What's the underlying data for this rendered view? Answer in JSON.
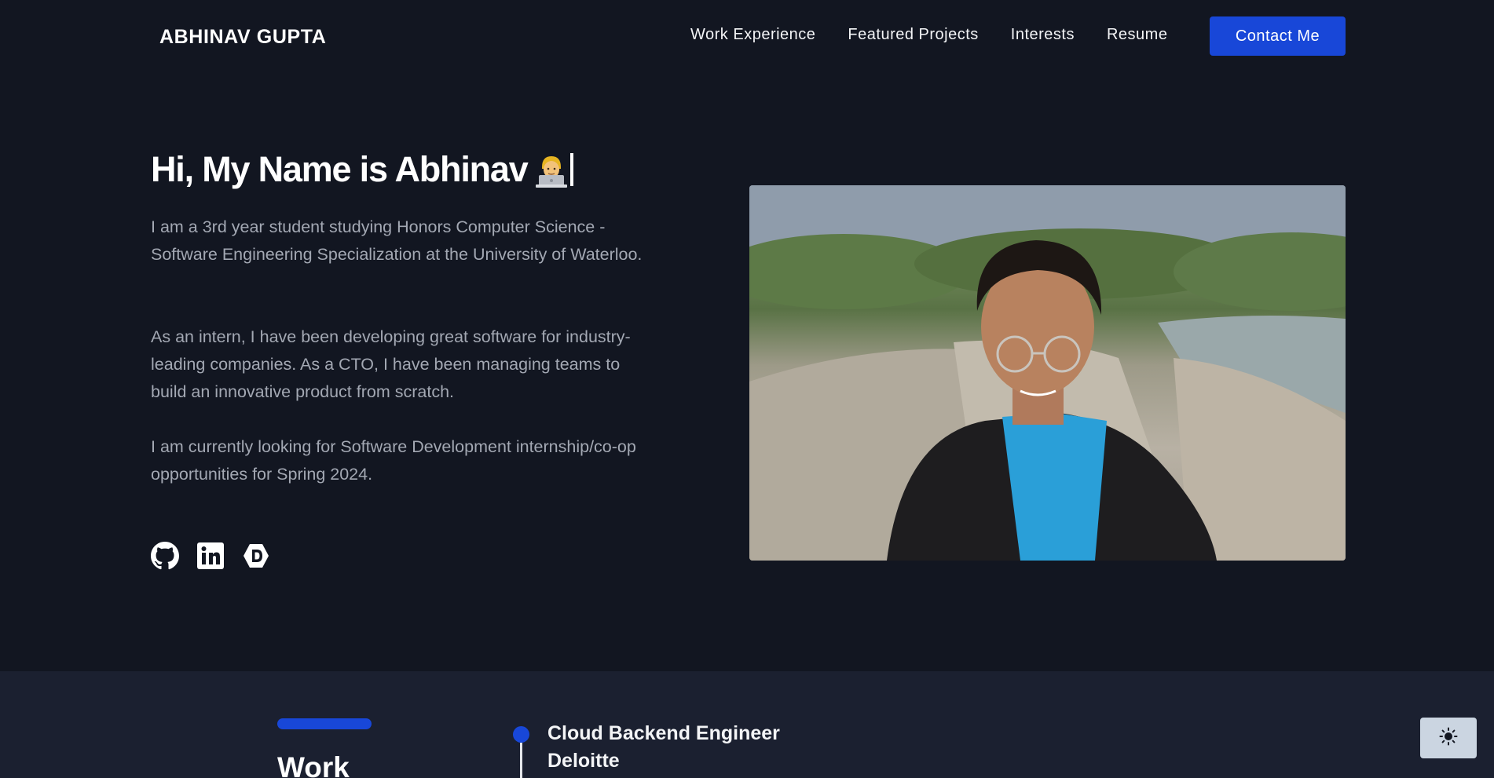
{
  "header": {
    "brand": "ABHINAV GUPTA",
    "nav": [
      "Work Experience",
      "Featured Projects",
      "Interests",
      "Resume"
    ],
    "contact_label": "Contact Me"
  },
  "hero": {
    "title": "Hi, My Name is Abhinav",
    "emoji": "technologist-emoji",
    "bio": [
      "I am a 3rd year student studying Honors Computer Science - Software Engineering Specialization at the University of Waterloo.",
      "As an intern, I have been developing great software for industry-leading companies. As a CTO, I have been managing teams to build an innovative product from scratch.",
      "I am currently looking for Software Development internship/co-op opportunities for Spring 2024."
    ],
    "socials": [
      "github-icon",
      "linkedin-icon",
      "devpost-icon"
    ],
    "photo": "profile-photo"
  },
  "work": {
    "heading": "Work",
    "jobs": [
      {
        "title": "Cloud Backend Engineer",
        "company": "Deloitte"
      }
    ]
  },
  "theme_toggle_icon": "sun-icon",
  "colors": {
    "background": "#121621",
    "section_background": "#1b2030",
    "accent": "#1847d8",
    "body_text": "#a3a8b3"
  }
}
